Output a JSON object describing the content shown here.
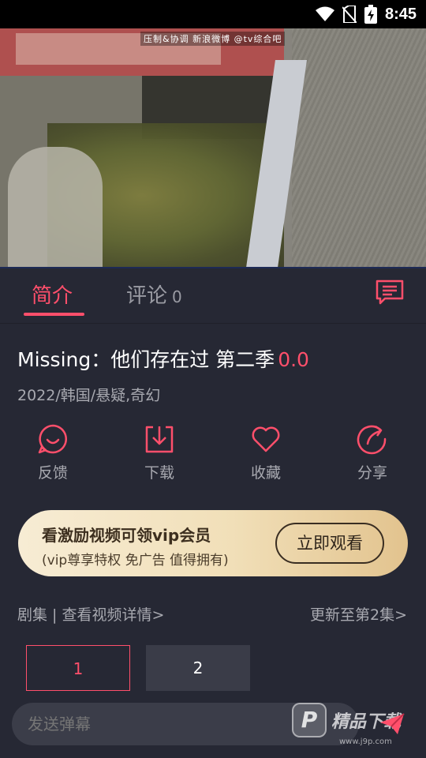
{
  "status_bar": {
    "time": "8:45"
  },
  "player": {
    "watermark": "压制&协调 新浪微博 @tv综合吧"
  },
  "tabs": {
    "intro_label": "简介",
    "comments_label": "评论",
    "comments_count": "0"
  },
  "show": {
    "title": "Missing：他们存在过 第二季",
    "score": "0.0",
    "meta": "2022/韩国/悬疑,奇幻"
  },
  "actions": {
    "feedback": "反馈",
    "download": "下载",
    "favorite": "收藏",
    "share": "分享"
  },
  "vip_banner": {
    "title": "看激励视频可领vip会员",
    "subtitle": "(vip尊享特权 免广告 值得拥有)",
    "button": "立即观看"
  },
  "episodes": {
    "header": "剧集 | 查看视频详情>",
    "update": "更新至第2集>",
    "items": [
      "1",
      "2"
    ],
    "selected": "1"
  },
  "danmaku": {
    "placeholder": "发送弹幕"
  },
  "brand": {
    "name": "精品下载",
    "url": "www.j9p.com"
  },
  "colors": {
    "accent": "#ff4f6b",
    "background": "#262834",
    "vip_gold": "#e2c38e"
  }
}
